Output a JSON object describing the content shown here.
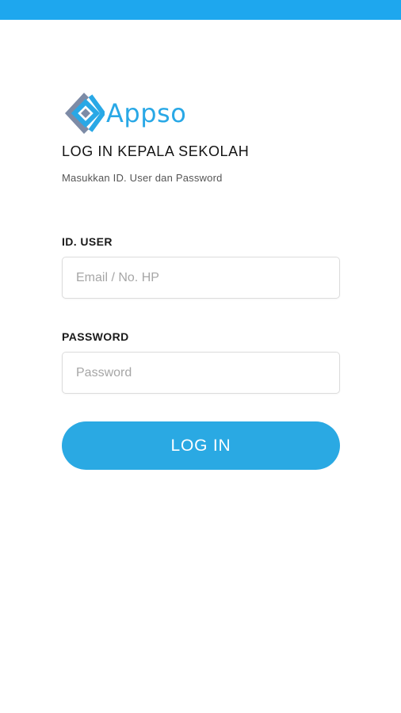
{
  "brand": {
    "logo_text": "Appso",
    "logo_icon": "appso-diamond-logo-icon",
    "color": "#29a8e6"
  },
  "status_bar": {
    "color": "#1ea7ee"
  },
  "login": {
    "title": "LOG IN KEPALA SEKOLAH",
    "subtitle": "Masukkan ID. User dan Password",
    "user_label": "ID. USER",
    "user_placeholder": "Email / No. HP",
    "user_value": "",
    "password_label": "PASSWORD",
    "password_placeholder": "Password",
    "password_value": "",
    "button_label": "LOG IN",
    "button_color": "#2aa9e3"
  }
}
